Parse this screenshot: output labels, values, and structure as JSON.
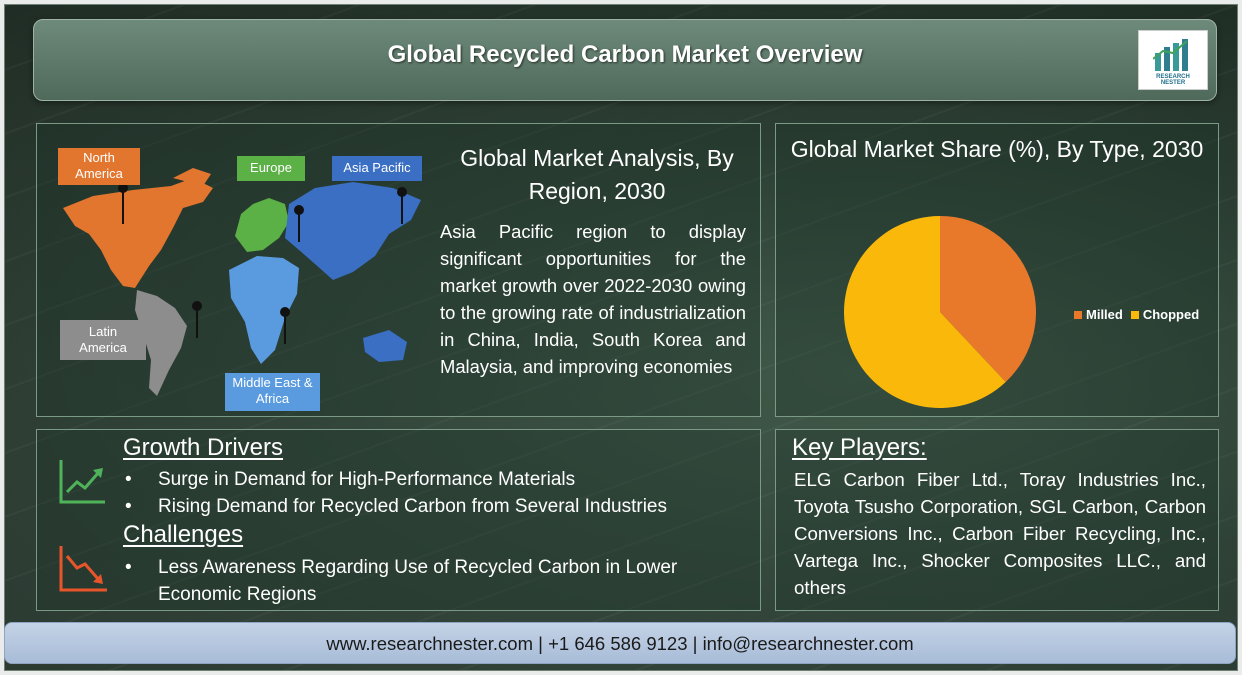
{
  "header": {
    "title": "Global Recycled Carbon Market Overview",
    "logo_text_1": "RESEARCH",
    "logo_text_2": "NESTER"
  },
  "map": {
    "title": "Global Market Analysis, By Region, 2030",
    "regions": [
      {
        "name": "North America",
        "color": "#e2762f"
      },
      {
        "name": "Europe",
        "color": "#5bb046"
      },
      {
        "name": "Asia Pacific",
        "color": "#3a6fc4"
      },
      {
        "name": "Latin America",
        "color": "#8d8d8d"
      },
      {
        "name": "Middle East & Africa",
        "color": "#5a9be0"
      }
    ],
    "labels": {
      "north_america": "North America",
      "europe": "Europe",
      "asia_pacific": "Asia Pacific",
      "latin_america": "Latin America",
      "mea": "Middle East & Africa"
    },
    "description": "Asia Pacific region to display significant opportunities for the market growth over 2022-2030 owing to the growing rate of industrialization in China, India, South Korea and Malaysia, and improving economies"
  },
  "pie": {
    "title": "Global Market Share (%), By Type, 2030"
  },
  "chart_data": {
    "type": "pie",
    "title": "Global Market Share (%), By Type, 2030",
    "categories": [
      "Milled",
      "Chopped"
    ],
    "values": [
      38,
      62
    ],
    "colors": [
      "#e8792a",
      "#fab90a"
    ],
    "legend": "right"
  },
  "drivers": {
    "heading": "Growth Drivers",
    "items": [
      "Surge in Demand for High-Performance Materials",
      "Rising Demand for Recycled Carbon from Several Industries"
    ],
    "icon": "trend-up-icon"
  },
  "challenges": {
    "heading": "Challenges",
    "items": [
      "Less Awareness Regarding Use of Recycled Carbon in Lower Economic Regions"
    ],
    "icon": "trend-down-icon"
  },
  "players": {
    "heading": "Key Players:",
    "text": "ELG Carbon Fiber Ltd., Toray Industries Inc., Toyota Tsusho Corporation, SGL Carbon, Carbon Conversions Inc., Carbon Fiber Recycling, Inc., Vartega Inc., Shocker Composites LLC., and others"
  },
  "footer": {
    "text": "www.researchnester.com | +1 646 586 9123 | info@researchnester.com"
  }
}
